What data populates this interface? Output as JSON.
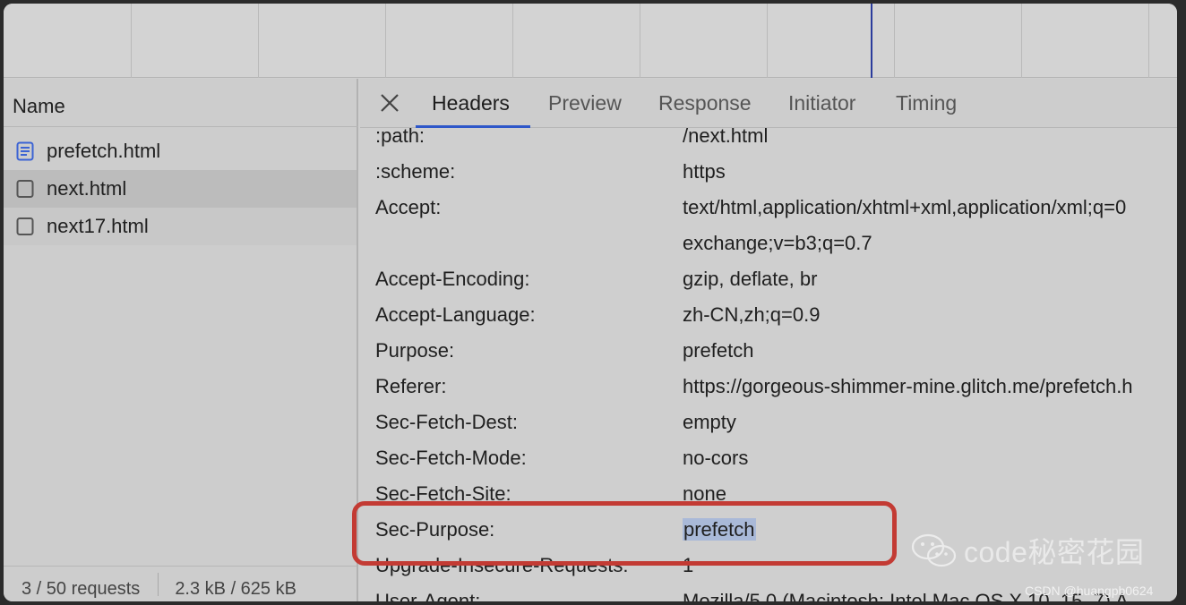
{
  "left_panel": {
    "name_header": "Name",
    "requests": [
      {
        "name": "prefetch.html",
        "icon": "document-icon",
        "selected": false
      },
      {
        "name": "next.html",
        "icon": "blank-file-icon",
        "selected": true
      },
      {
        "name": "next17.html",
        "icon": "blank-file-icon",
        "selected": false
      }
    ],
    "status": {
      "requests": "3 / 50 requests",
      "size": "2.3 kB / 625 kB"
    }
  },
  "tabs": [
    "Headers",
    "Preview",
    "Response",
    "Initiator",
    "Timing"
  ],
  "active_tab": "Headers",
  "request_headers": [
    {
      "key": ":path:",
      "value": "/next.html"
    },
    {
      "key": ":scheme:",
      "value": "https"
    },
    {
      "key": "Accept:",
      "value": "text/html,application/xhtml+xml,application/xml;q=0"
    },
    {
      "key": "",
      "value": "exchange;v=b3;q=0.7"
    },
    {
      "key": "Accept-Encoding:",
      "value": "gzip, deflate, br"
    },
    {
      "key": "Accept-Language:",
      "value": "zh-CN,zh;q=0.9"
    },
    {
      "key": "Purpose:",
      "value": "prefetch"
    },
    {
      "key": "Referer:",
      "value": "https://gorgeous-shimmer-mine.glitch.me/prefetch.h"
    },
    {
      "key": "Sec-Fetch-Dest:",
      "value": "empty"
    },
    {
      "key": "Sec-Fetch-Mode:",
      "value": "no-cors"
    },
    {
      "key": "Sec-Fetch-Site:",
      "value": "none"
    },
    {
      "key": "Sec-Purpose:",
      "value": "prefetch"
    },
    {
      "key": "Upgrade-Insecure-Requests:",
      "value": "1"
    },
    {
      "key": "User-Agent:",
      "value": "Mozilla/5.0 (Macintosh; Intel Mac OS X 10_15_7) A"
    }
  ],
  "watermark": {
    "text": "code秘密花园",
    "icon": "wechat-icon"
  },
  "credit": "CSDN @huangpb0624",
  "colors": {
    "accent": "#2e57c9",
    "annotation": "#c33b34",
    "selection": "#a9b9d8"
  }
}
